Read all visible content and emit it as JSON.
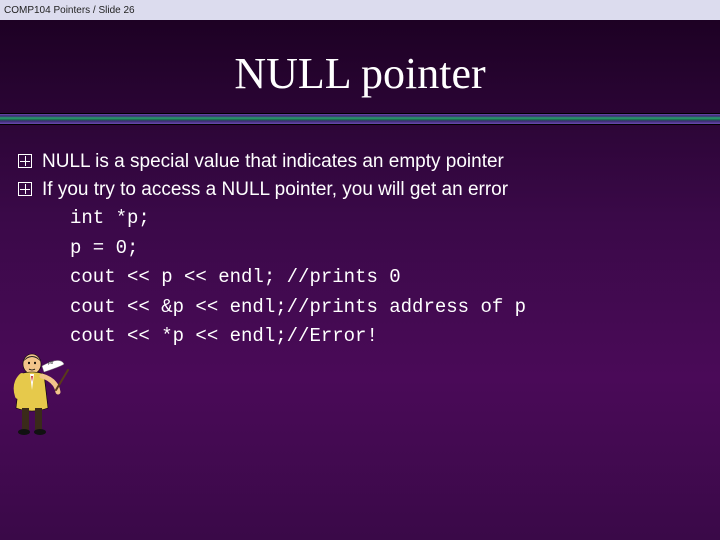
{
  "header": {
    "course_slide": "COMP104 Pointers / Slide 26"
  },
  "title": "NULL pointer",
  "bullets": [
    "NULL is a special value that indicates an empty pointer",
    "If you try to access a NULL pointer, you will get an error"
  ],
  "code_lines": [
    "int *p;",
    "p = 0;",
    "cout << p << endl; //prints 0",
    "cout << &p << endl;//prints address of p",
    "cout << *p << endl;//Error!"
  ]
}
